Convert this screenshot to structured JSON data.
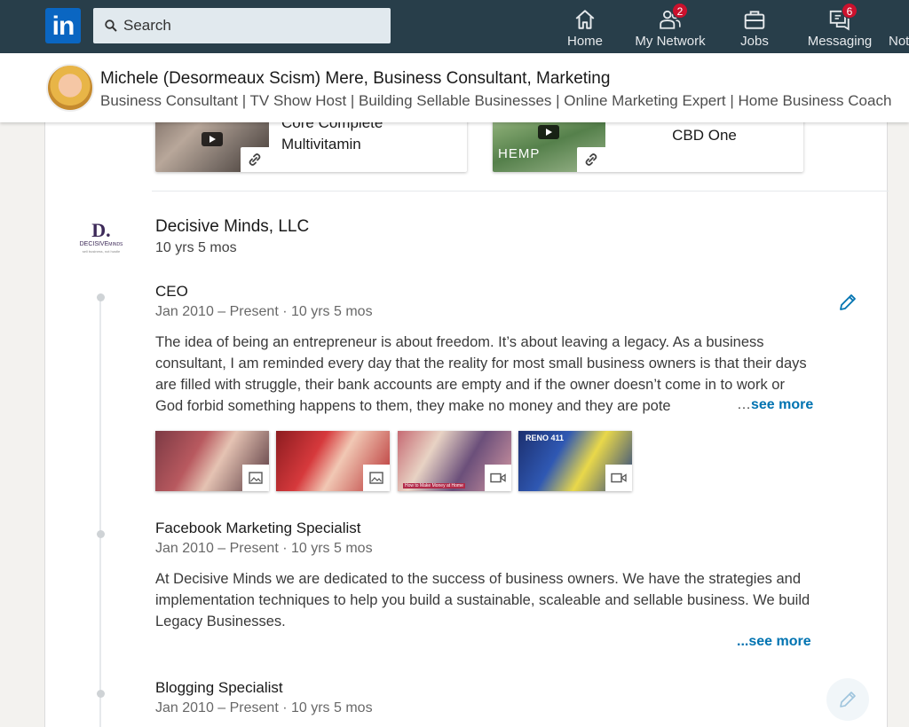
{
  "nav": {
    "logo_text": "in",
    "search_placeholder": "Search",
    "items": [
      {
        "label": "Home",
        "icon": "home-icon"
      },
      {
        "label": "My Network",
        "icon": "network-icon",
        "badge": "2"
      },
      {
        "label": "Jobs",
        "icon": "briefcase-icon"
      },
      {
        "label": "Messaging",
        "icon": "messaging-icon",
        "badge": "6"
      },
      {
        "label": "Not",
        "icon": "bell-icon"
      }
    ]
  },
  "profile": {
    "name": "Michele (Desormeaux Scism) Mere, Business Consultant, Marketing",
    "headline": "Business Consultant | TV Show Host | Building Sellable Businesses | Online Marketing Expert | Home Business Coach"
  },
  "featured_media": [
    {
      "title_line1": "Core Complete",
      "title_line2": "Multivitamin"
    },
    {
      "title": "CBD One",
      "thumb_text": "HEMP"
    }
  ],
  "company": {
    "logo_letter": "D.",
    "logo_word_a": "DECISIVE",
    "logo_word_b": "MINDS",
    "logo_tagline": "sell business, not hustle",
    "name": "Decisive Minds, LLC",
    "duration": "10 yrs 5 mos"
  },
  "roles": [
    {
      "title": "CEO",
      "dates": "Jan 2010 – Present · 10 yrs 5 mos",
      "description": "The idea of being an entrepreneur is about freedom. It’s about leaving a legacy. As a business consultant, I am reminded every day that the reality for most small business owners is that their days are filled with struggle, their bank accounts are empty and if the owner doesn’t come in to work or God forbid something happens to them, they make no money and they are pote",
      "ellipsis": "…",
      "see_more": "see more",
      "media_tiles": [
        {
          "type": "image",
          "icon": "image-icon"
        },
        {
          "type": "image",
          "icon": "image-icon"
        },
        {
          "type": "video",
          "icon": "video-icon",
          "caption": "How to Make Money at Home"
        },
        {
          "type": "video",
          "icon": "video-icon",
          "caption": "RENO 411"
        }
      ]
    },
    {
      "title": "Facebook Marketing Specialist",
      "dates": "Jan 2010 – Present · 10 yrs 5 mos",
      "description": "At Decisive Minds we are dedicated to the success of business owners. We have the strategies and implementation techniques to help you build a sustainable, scaleable and sellable business. We build Legacy Businesses.",
      "ellipsis": "...",
      "see_more": "see more"
    },
    {
      "title": "Blogging Specialist",
      "dates": "Jan 2010 – Present · 10 yrs 5 mos"
    }
  ],
  "colors": {
    "nav_bg": "#283e4a",
    "link": "#0073b1",
    "badge": "#cb112d"
  }
}
